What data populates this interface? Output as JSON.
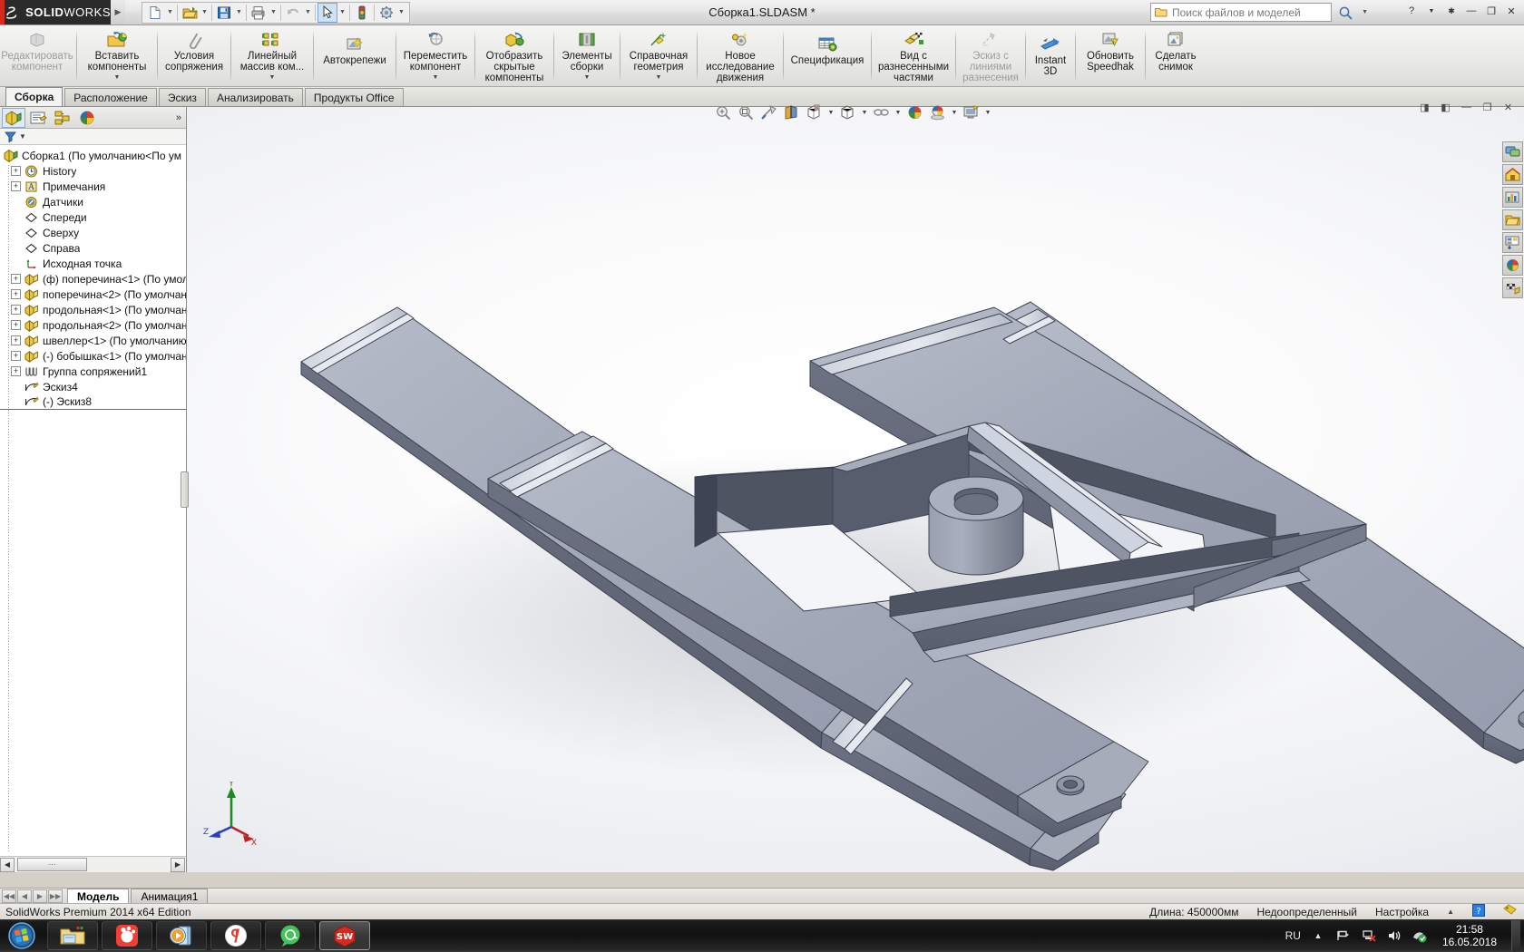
{
  "titlebar": {
    "brand_main": "SOLID",
    "brand_thin": "WORKS",
    "document_title": "Сборка1.SLDASM *",
    "search_placeholder": "Поиск файлов и моделей",
    "help_label": "?",
    "qat": [
      {
        "name": "new-document",
        "icon": "new-doc-icon"
      },
      {
        "name": "open-document",
        "icon": "open-folder-icon"
      },
      {
        "name": "save-document",
        "icon": "save-disk-icon"
      },
      {
        "name": "print-document",
        "icon": "printer-icon"
      },
      {
        "name": "undo",
        "icon": "undo-arrow-icon"
      },
      {
        "name": "select",
        "icon": "cursor-arrow-icon"
      },
      {
        "name": "rebuild",
        "icon": "traffic-light-icon"
      },
      {
        "name": "options",
        "icon": "gear-icon"
      }
    ]
  },
  "ribbon": {
    "commands": [
      {
        "label": "Редактировать\nкомпонент",
        "icon": "edit-component-icon",
        "disabled": true,
        "caret": false
      },
      {
        "label": "Вставить\nкомпоненты",
        "icon": "insert-components-icon",
        "disabled": false,
        "caret": true
      },
      {
        "label": "Условия\nсопряжения",
        "icon": "mate-paperclip-icon",
        "disabled": false,
        "caret": false
      },
      {
        "label": "Линейный\nмассив ком...",
        "icon": "linear-pattern-icon",
        "disabled": false,
        "caret": true
      },
      {
        "label": "Автокрепежи",
        "icon": "smart-fasteners-icon",
        "disabled": false,
        "caret": false
      },
      {
        "label": "Переместить\nкомпонент",
        "icon": "move-component-icon",
        "disabled": false,
        "caret": true
      },
      {
        "label": "Отобразить\nскрытые\nкомпоненты",
        "icon": "show-hidden-components-icon",
        "disabled": false,
        "caret": false
      },
      {
        "label": "Элементы\nсборки",
        "icon": "assembly-features-icon",
        "disabled": false,
        "caret": true
      },
      {
        "label": "Справочная\nгеометрия",
        "icon": "reference-geometry-icon",
        "disabled": false,
        "caret": true
      },
      {
        "label": "Новое\nисследование\nдвижения",
        "icon": "new-motion-study-icon",
        "disabled": false,
        "caret": false
      },
      {
        "label": "Спецификация",
        "icon": "bill-of-materials-icon",
        "disabled": false,
        "caret": false
      },
      {
        "label": "Вид с\nразнесенными\nчастями",
        "icon": "exploded-view-icon",
        "disabled": false,
        "caret": false
      },
      {
        "label": "Эскиз с\nлиниями\nразнесения",
        "icon": "explode-line-sketch-icon",
        "disabled": true,
        "caret": false
      },
      {
        "label": "Instant\n3D",
        "icon": "instant-3d-icon",
        "disabled": false,
        "caret": false
      },
      {
        "label": "Обновить\nSpeedhak",
        "icon": "update-speedpak-icon",
        "disabled": false,
        "caret": false
      },
      {
        "label": "Сделать\nснимок",
        "icon": "take-snapshot-icon",
        "disabled": false,
        "caret": false
      }
    ]
  },
  "tabs": [
    {
      "label": "Сборка",
      "active": true
    },
    {
      "label": "Расположение",
      "active": false
    },
    {
      "label": "Эскиз",
      "active": false
    },
    {
      "label": "Анализировать",
      "active": false
    },
    {
      "label": "Продукты Office",
      "active": false
    }
  ],
  "view_toolbar": [
    {
      "name": "zoom-to-fit-icon",
      "caret": false
    },
    {
      "name": "zoom-to-area-icon",
      "caret": false
    },
    {
      "name": "previous-view-icon",
      "caret": false
    },
    {
      "name": "section-view-icon",
      "caret": false
    },
    {
      "name": "view-orientation-icon",
      "caret": true
    },
    {
      "name": "display-style-icon",
      "caret": true
    },
    {
      "name": "hide-show-items-icon",
      "caret": true
    },
    {
      "name": "edit-appearance-icon",
      "caret": false
    },
    {
      "name": "apply-scene-icon",
      "caret": true
    },
    {
      "name": "view-settings-icon",
      "caret": true
    }
  ],
  "window_controls": [
    {
      "name": "restore-left-pane-button",
      "glyph": "◨"
    },
    {
      "name": "restore-right-pane-button",
      "glyph": "◧"
    },
    {
      "name": "minimize-button",
      "glyph": "—"
    },
    {
      "name": "restore-button",
      "glyph": "❐"
    },
    {
      "name": "close-button",
      "glyph": "✕"
    }
  ],
  "feature_manager": {
    "tabs": [
      {
        "name": "feature-manager-tree-tab",
        "icon": "feature-tree-icon",
        "selected": true
      },
      {
        "name": "property-manager-tab",
        "icon": "property-manager-icon",
        "selected": false
      },
      {
        "name": "configuration-manager-tab",
        "icon": "configuration-manager-icon",
        "selected": false
      },
      {
        "name": "display-manager-tab",
        "icon": "display-manager-icon",
        "selected": false
      }
    ],
    "expand_glyph": "»",
    "filter_icon": "filter-funnel-icon",
    "root": {
      "label": "Сборка1  (По умолчанию<По ум",
      "icon": "assembly-icon"
    },
    "nodes": [
      {
        "label": "History",
        "icon": "history-clock-icon",
        "expandable": true,
        "indent": 1
      },
      {
        "label": "Примечания",
        "icon": "annotations-icon",
        "expandable": true,
        "indent": 1
      },
      {
        "label": "Датчики",
        "icon": "sensors-icon",
        "expandable": false,
        "indent": 1
      },
      {
        "label": "Спереди",
        "icon": "plane-icon",
        "expandable": false,
        "indent": 1
      },
      {
        "label": "Сверху",
        "icon": "plane-icon",
        "expandable": false,
        "indent": 1
      },
      {
        "label": "Справа",
        "icon": "plane-icon",
        "expandable": false,
        "indent": 1
      },
      {
        "label": "Исходная точка",
        "icon": "origin-icon",
        "expandable": false,
        "indent": 1
      },
      {
        "label": "(ф) поперечина<1> (По умол",
        "icon": "part-icon",
        "expandable": true,
        "indent": 1
      },
      {
        "label": "поперечина<2> (По умолчан",
        "icon": "part-icon",
        "expandable": true,
        "indent": 1
      },
      {
        "label": "продольная<1> (По умолчани",
        "icon": "part-icon",
        "expandable": true,
        "indent": 1
      },
      {
        "label": "продольная<2> (По умолчани",
        "icon": "part-icon",
        "expandable": true,
        "indent": 1
      },
      {
        "label": "швеллер<1> (По умолчанию",
        "icon": "part-icon",
        "expandable": true,
        "indent": 1
      },
      {
        "label": "(-) бобышка<1> (По умолчан",
        "icon": "part-icon",
        "expandable": true,
        "indent": 1
      },
      {
        "label": "Группа сопряжений1",
        "icon": "mate-group-icon",
        "expandable": true,
        "indent": 1
      },
      {
        "label": "Эскиз4",
        "icon": "sketch-icon",
        "expandable": false,
        "indent": 1
      },
      {
        "label": "(-) Эскиз8",
        "icon": "sketch-icon",
        "expandable": false,
        "indent": 1
      }
    ]
  },
  "right_rail": [
    {
      "name": "solidworks-resources-icon"
    },
    {
      "name": "design-library-icon"
    },
    {
      "name": "file-explorer-icon"
    },
    {
      "name": "search-folder-icon"
    },
    {
      "name": "view-palette-icon"
    },
    {
      "name": "appearances-scenes-icon"
    },
    {
      "name": "custom-properties-icon"
    }
  ],
  "document_tabs": {
    "nav_buttons": [
      "first-tab-button",
      "prev-tab-button",
      "next-tab-button",
      "last-tab-button"
    ],
    "tabs": [
      {
        "label": "Модель",
        "active": true
      },
      {
        "label": "Анимация1",
        "active": false
      }
    ]
  },
  "statusbar": {
    "edition": "SolidWorks Premium 2014 x64 Edition",
    "length": "Длина: 450000мм",
    "state": "Недоопределенный",
    "settings": "Настройка",
    "caret": "▲",
    "help_icon": "help-question-icon",
    "tag_icon": "tag-icon"
  },
  "taskbar": {
    "start": "windows-start-orb",
    "items": [
      {
        "name": "file-explorer-taskbar-icon",
        "active": false
      },
      {
        "name": "gom-player-taskbar-icon",
        "active": false
      },
      {
        "name": "media-player-taskbar-icon",
        "active": false
      },
      {
        "name": "yandex-browser-taskbar-icon",
        "active": false
      },
      {
        "name": "icq-taskbar-icon",
        "active": false
      },
      {
        "name": "solidworks-taskbar-icon",
        "active": true
      }
    ],
    "tray": {
      "language": "RU",
      "icons": [
        "show-hidden-tray-icon",
        "flag-action-center-icon",
        "network-error-icon",
        "volume-icon",
        "antivirus-icon"
      ],
      "time": "21:58",
      "date": "16.05.2018"
    }
  },
  "colors": {
    "accent_red": "#d42b1e",
    "chrome": "#d4d0c8",
    "metal_light": "#a8adba",
    "metal_mid": "#8f95a5",
    "metal_dark": "#5e6372",
    "taskbar": "#111111"
  }
}
